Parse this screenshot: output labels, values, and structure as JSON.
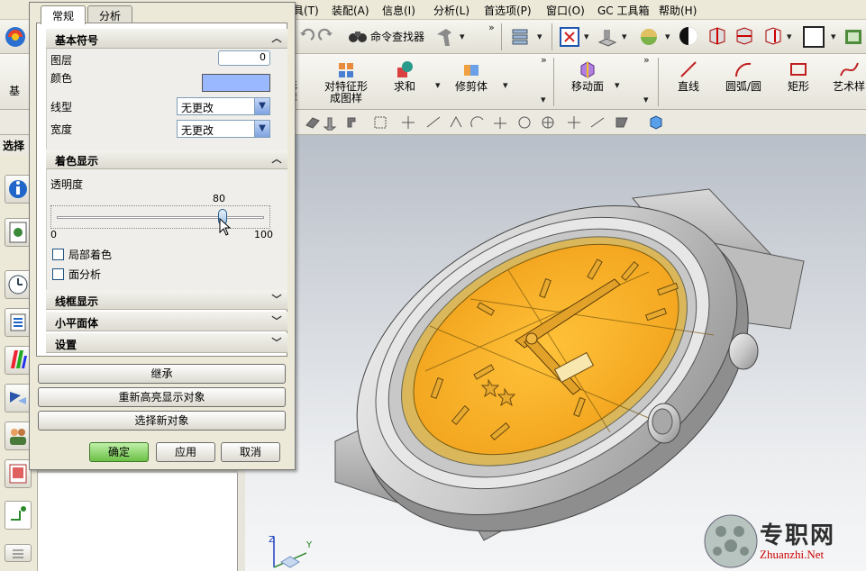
{
  "menubar": {
    "items": [
      "具(T)",
      "装配(A)",
      "信息(I)",
      "分析(L)",
      "首选项(P)",
      "窗口(O)",
      "GC 工具箱",
      "帮助(H)"
    ]
  },
  "toolbar1": {
    "command_finder": "命令查找器"
  },
  "toolbar2": {
    "pattern_left_1": "形",
    "pattern_left_2": "样",
    "pattern_face_1": "对特征形",
    "pattern_face_2": "成图样",
    "unite": "求和",
    "trim_body": "修剪体",
    "move_face": "移动面",
    "line": "直线",
    "arc": "圆弧/圆",
    "rectangle": "矩形",
    "studio_spline": "艺术样",
    "partial_left": "基"
  },
  "selbar": {
    "partial_label": "选择"
  },
  "dialog": {
    "tabs": [
      "常规",
      "分析"
    ],
    "basic_symbol": {
      "header": "基本符号",
      "layer_label": "图层",
      "layer_value": "0",
      "color_label": "颜色",
      "color": "#99b8ff",
      "linetype_label": "线型",
      "linetype_value": "无更改",
      "width_label": "宽度",
      "width_value": "无更改"
    },
    "shaded": {
      "header": "着色显示",
      "transparency_label": "透明度",
      "transparency_value": "80",
      "slider_min": "0",
      "slider_max": "100",
      "slider_level": 80,
      "partial_shading": "局部着色",
      "face_analysis": "面分析"
    },
    "wireframe_header": "线框显示",
    "facet_header": "小平面体",
    "settings_header": "设置",
    "inherit": "继承",
    "rehighlight": "重新高亮显示对象",
    "reselect": "选择新对象",
    "ok": "确定",
    "apply": "应用",
    "cancel": "取消"
  },
  "triad": {
    "x": "X",
    "y": "Y",
    "z": "Z"
  },
  "watermark": {
    "cn": "专职网",
    "en": "Zhuanzhi.Net"
  }
}
